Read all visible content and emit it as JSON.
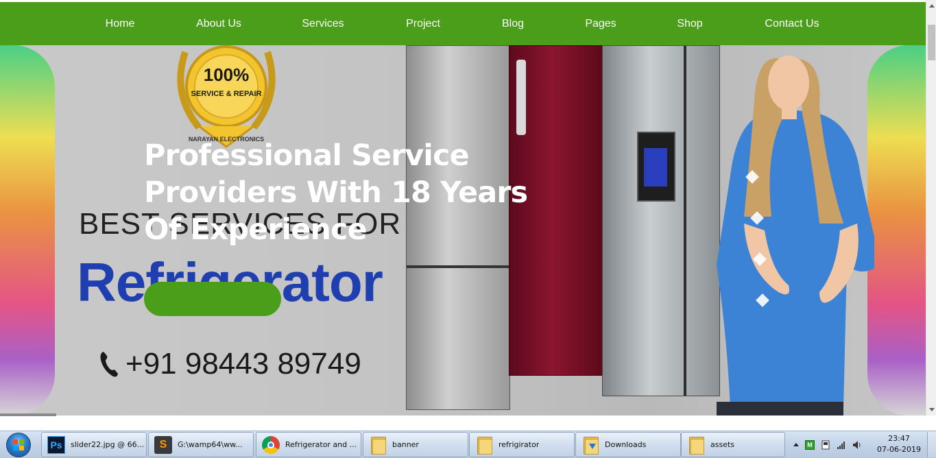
{
  "nav": {
    "items": [
      {
        "label": "Home"
      },
      {
        "label": "About Us"
      },
      {
        "label": "Services"
      },
      {
        "label": "Project"
      },
      {
        "label": "Blog"
      },
      {
        "label": "Pages"
      },
      {
        "label": "Shop"
      },
      {
        "label": "Contact Us"
      }
    ],
    "background_color": "#4a9e19"
  },
  "hero": {
    "title": "Professional Service Providers With 18 Years Of Experience",
    "cta_color": "#4a9e19",
    "banner_image": {
      "badge_percent": "100%",
      "badge_text": "SERVICE & REPAIR",
      "badge_ring": "NARAYAN ELECTRONICS",
      "tagline": "BEST SERVICES FOR",
      "product": "Refrigerator",
      "phone": "+91 98443 89749"
    }
  },
  "taskbar": {
    "buttons": [
      {
        "icon": "photoshop-icon",
        "label": "slider22.jpg @ 66..."
      },
      {
        "icon": "sublime-text-icon",
        "label": "G:\\wamp64\\ww..."
      },
      {
        "icon": "chrome-icon",
        "label": "Refrigerator and ..."
      },
      {
        "icon": "folder-icon",
        "label": "banner"
      },
      {
        "icon": "folder-icon",
        "label": "refrigirator"
      },
      {
        "icon": "downloads-folder-icon",
        "label": "Downloads"
      },
      {
        "icon": "folder-icon",
        "label": "assets"
      }
    ],
    "clock": {
      "time": "23:47",
      "date": "07-06-2019"
    },
    "tray_icons": [
      "show-hidden-icons-arrow",
      "green-app-icon",
      "device-icon",
      "network-signal-icon",
      "volume-icon"
    ]
  }
}
